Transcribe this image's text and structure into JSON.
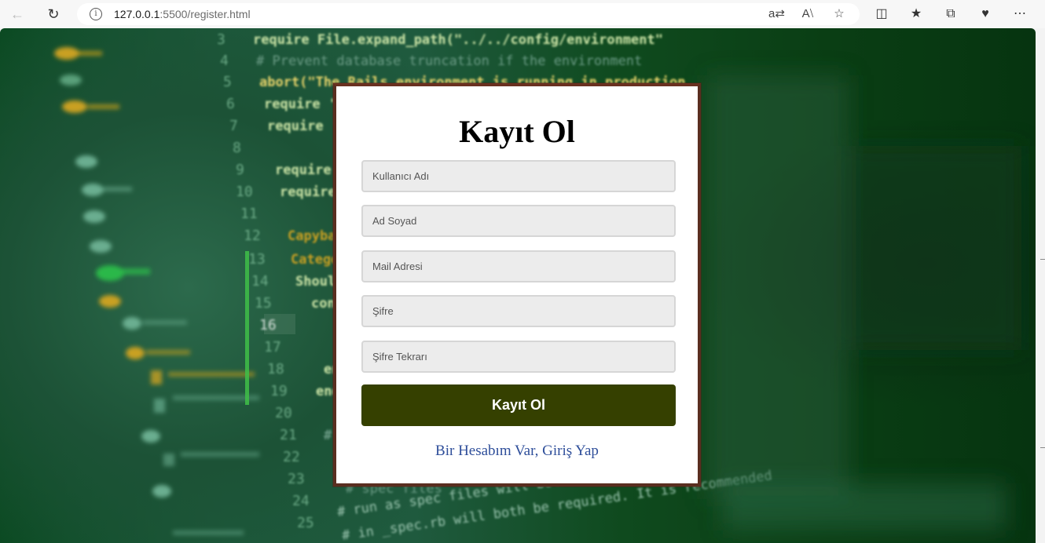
{
  "browser": {
    "url_host": "127.0.0.1",
    "url_rest": ":5500/register.html"
  },
  "background": {
    "line_numbers": [
      "3",
      "4",
      "5",
      "6",
      "7",
      "8",
      "9",
      "10",
      "11",
      "12",
      "13",
      "14",
      "15",
      "16",
      "17",
      "18",
      "19",
      "20",
      "21",
      "22",
      "23",
      "24",
      "25"
    ],
    "code_lines": [
      "require File.expand_path(\"../../config/environment\"",
      "# Prevent database truncation if the environment is production",
      "abort(\"The Rails environment is running in production mode!\")",
      "require 'sp",
      "require 'r",
      "",
      "require '",
      "require '",
      "",
      "Capybar",
      "Categor",
      "Should",
      "conf",
      "",
      "",
      "en",
      "end",
      "",
      "#",
      "",
      "# spec files",
      "# run as spec files will both be",
      "# in _spec.rb will both be required. It is recommended that"
    ]
  },
  "form": {
    "title": "Kayıt Ol",
    "username_placeholder": "Kullanıcı Adı",
    "fullname_placeholder": "Ad Soyad",
    "email_placeholder": "Mail Adresi",
    "password_placeholder": "Şifre",
    "password_repeat_placeholder": "Şifre Tekrarı",
    "submit_label": "Kayıt Ol",
    "login_link": "Bir Hesabım Var, Giriş Yap"
  },
  "colors": {
    "submit_bg": "#354000",
    "link": "#2e4e9a",
    "card_border": "#5a2e20"
  }
}
